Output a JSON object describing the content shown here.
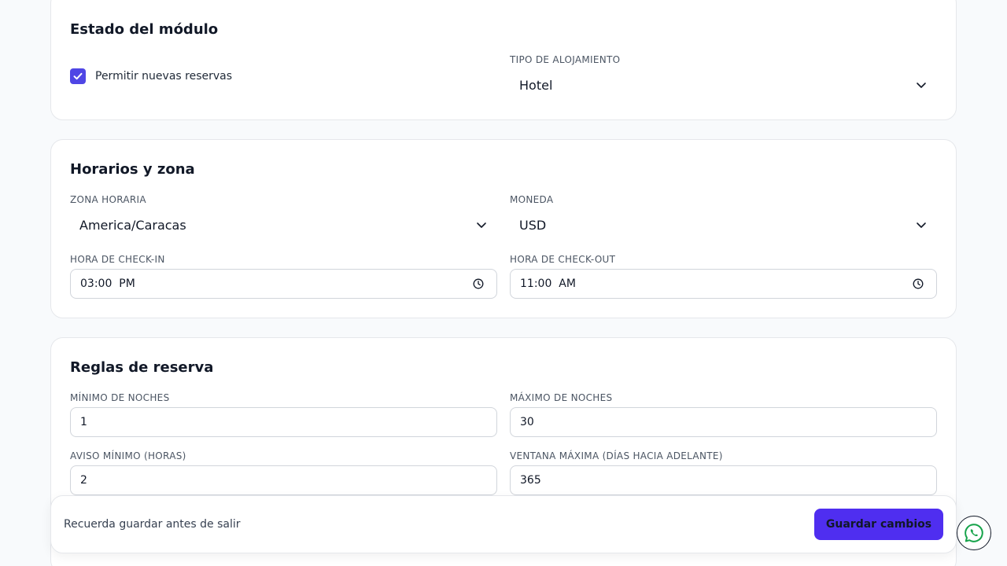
{
  "status_card": {
    "title": "Estado del módulo",
    "allow_bookings_label": "Permitir nuevas reservas",
    "allow_bookings_checked": true,
    "lodging_type_label": "TIPO DE ALOJAMIENTO",
    "lodging_type_value": "Hotel"
  },
  "hours_card": {
    "title": "Horarios y zona",
    "timezone_label": "ZONA HORARIA",
    "timezone_value": "America/Caracas",
    "currency_label": "MONEDA",
    "currency_value": "USD",
    "checkin_label": "HORA DE CHECK-IN",
    "checkin_value": "03:00  PM",
    "checkout_label": "HORA DE CHECK-OUT",
    "checkout_value": "11:00  AM"
  },
  "rules_card": {
    "title": "Reglas de reserva",
    "min_nights_label": "MÍNIMO DE NOCHES",
    "min_nights_value": "1",
    "max_nights_label": "MÁXIMO DE NOCHES",
    "max_nights_value": "30",
    "min_notice_label": "AVISO MÍNIMO (HORAS)",
    "min_notice_value": "2",
    "max_window_label": "VENTANA MÁXIMA (DÍAS HACIA ADELANTE)",
    "max_window_value": "365"
  },
  "footer": {
    "reminder_text": "Recuerda guardar antes de salir",
    "save_label": "Guardar cambios"
  },
  "colors": {
    "accent": "#4f2ef0",
    "checkbox": "#4f46e5",
    "page_bg": "#f8fafc"
  },
  "icons": [
    "checkbox-check-icon",
    "chevron-down-icon",
    "clock-icon",
    "whatsapp-icon"
  ]
}
